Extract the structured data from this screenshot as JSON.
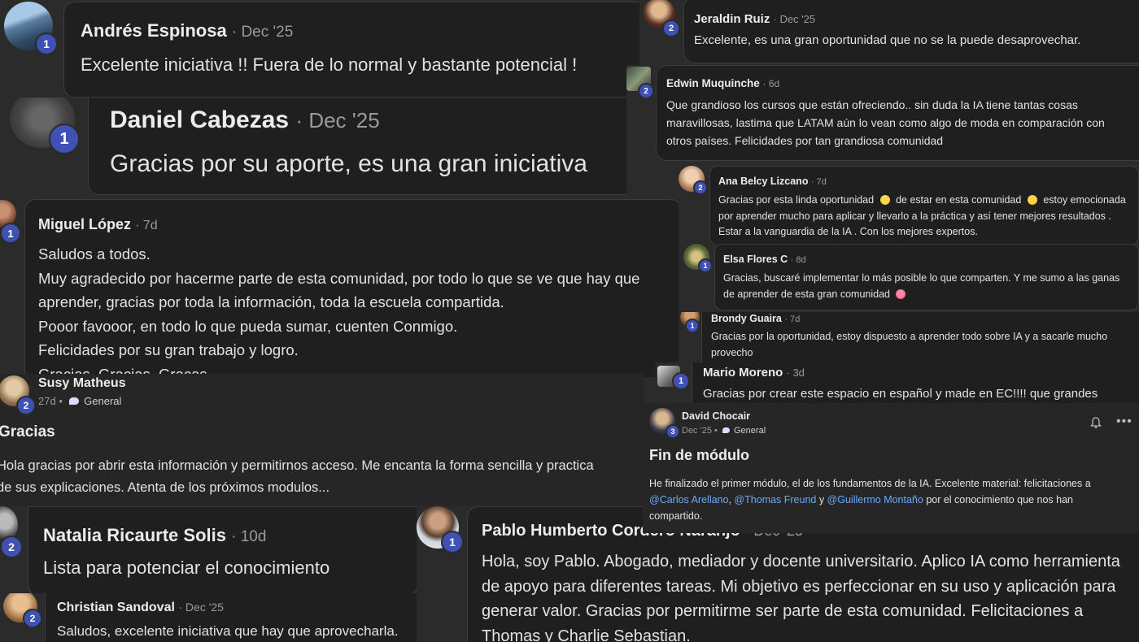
{
  "comments": {
    "andres": {
      "name": "Andrés Espinosa",
      "meta": "· Dec '25",
      "level": "1",
      "text": "Excelente iniciativa !! Fuera de lo normal y bastante potencial !"
    },
    "daniel": {
      "name": "Daniel Cabezas",
      "meta": "· Dec '25",
      "level": "1",
      "text": "Gracias por su aporte, es una gran iniciativa"
    },
    "miguel": {
      "name": "Miguel López",
      "meta": "· 7d",
      "level": "1",
      "lines": [
        "Saludos a todos.",
        "Muy agradecido por hacerme parte de esta comunidad, por todo lo que se ve que hay que",
        "aprender, gracias por toda la información, toda la escuela compartida.",
        "Pooor favooor, en todo lo que pueda sumar, cuenten Conmigo.",
        "Felicidades por su gran trabajo y logro.",
        "Gracias, Gracias, Gracas."
      ]
    },
    "natalia": {
      "name": "Natalia Ricaurte Solis",
      "meta": "· 10d",
      "level": "2",
      "text": "Lista para potenciar el conocimiento"
    },
    "christian": {
      "name": "Christian Sandoval",
      "meta": "· Dec '25",
      "level": "2",
      "text": "Saludos, excelente iniciativa que hay que aprovecharla."
    },
    "pablo": {
      "name": "Pablo Humberto Cordero Naranjo",
      "meta": "· Dec '25",
      "level": "1",
      "lines": [
        "Hola, soy Pablo. Abogado, mediador y docente universitario. Aplico IA como herramienta",
        "de apoyo para diferentes tareas. Mi objetivo es perfeccionar en su uso y aplicación para",
        "generar valor. Gracias por permitirme ser parte de esta comunidad. Felicitaciones a",
        "Thomas y Charlie Sebastian."
      ]
    },
    "jeraldin": {
      "name": "Jeraldin Ruiz",
      "meta": "· Dec '25",
      "level": "2",
      "text": "Excelente, es una gran oportunidad que no se la puede desaprovechar."
    },
    "edwin": {
      "name": "Edwin Muquinche",
      "meta": "· 6d",
      "level": "2",
      "lines": [
        "Que grandioso los cursos que están ofreciendo.. sin duda la IA tiene tantas cosas",
        "maravillosas, lastima que LATAM aún lo vean como algo de moda en comparación con",
        "otros países. Felicidades por tan grandiosa comunidad"
      ]
    },
    "ana": {
      "name": "Ana Belcy Lizcano",
      "meta": "· 7d",
      "level": "2",
      "l1a": "Gracias por esta linda oportunidad",
      "l1b": "de estar en esta comunidad",
      "l1c": "estoy emocionada",
      "l2": "por aprender mucho para aplicar y llevarlo a la práctica y así tener mejores resultados .",
      "l3": "Estar a la vanguardia de la IA . Con los mejores expertos."
    },
    "elsa": {
      "name": "Elsa Flores C",
      "meta": "· 8d",
      "level": "1",
      "l1": "Gracias, buscaré implementar lo más posible lo que comparten. Y me sumo a las ganas",
      "l2": "de aprender de esta gran comunidad"
    },
    "brondy": {
      "name": "Brondy Guaira",
      "meta": "· 7d",
      "level": "1",
      "lines": [
        "Gracias por la oportunidad, estoy dispuesto a aprender todo sobre IA y a sacarle mucho",
        "provecho"
      ]
    },
    "mario": {
      "name": "Mario Moreno",
      "meta": "· 3d",
      "level": "1",
      "text": "Gracias por crear este espacio en español y made en EC!!!! que grandes"
    }
  },
  "posts": {
    "susy": {
      "name": "Susy Matheus",
      "time": "27d",
      "sep": "•",
      "category": "General",
      "level": "2",
      "title": "Gracias",
      "lines": [
        "Hola gracias por abrir esta información y permitirnos acceso. Me encanta la forma sencilla y practica",
        "de sus explicaciones. Atenta de los próximos modulos..."
      ]
    },
    "david": {
      "name": "David Chocair",
      "time": "Dec '25",
      "sep": "•",
      "category": "General",
      "level": "3",
      "title": "Fin de módulo",
      "t1": "He finalizado el primer módulo, el de los fundamentos de la IA. Excelente material: felicitaciones a",
      "m1": "@Carlos Arellano",
      "s1": ", ",
      "m2": "@Thomas Freund",
      "s2": " y ",
      "m3": "@Guillermo Montaño",
      "t2": " por el conocimiento que nos han",
      "t3": "compartido."
    }
  },
  "icons": [
    "bell-icon",
    "more-icon",
    "chat-bubble-icon"
  ],
  "colors": {
    "badge": "#3f51b5",
    "mention": "#6aa9ff",
    "bubble": "#1f1f20",
    "background": "#2b2b2b"
  }
}
